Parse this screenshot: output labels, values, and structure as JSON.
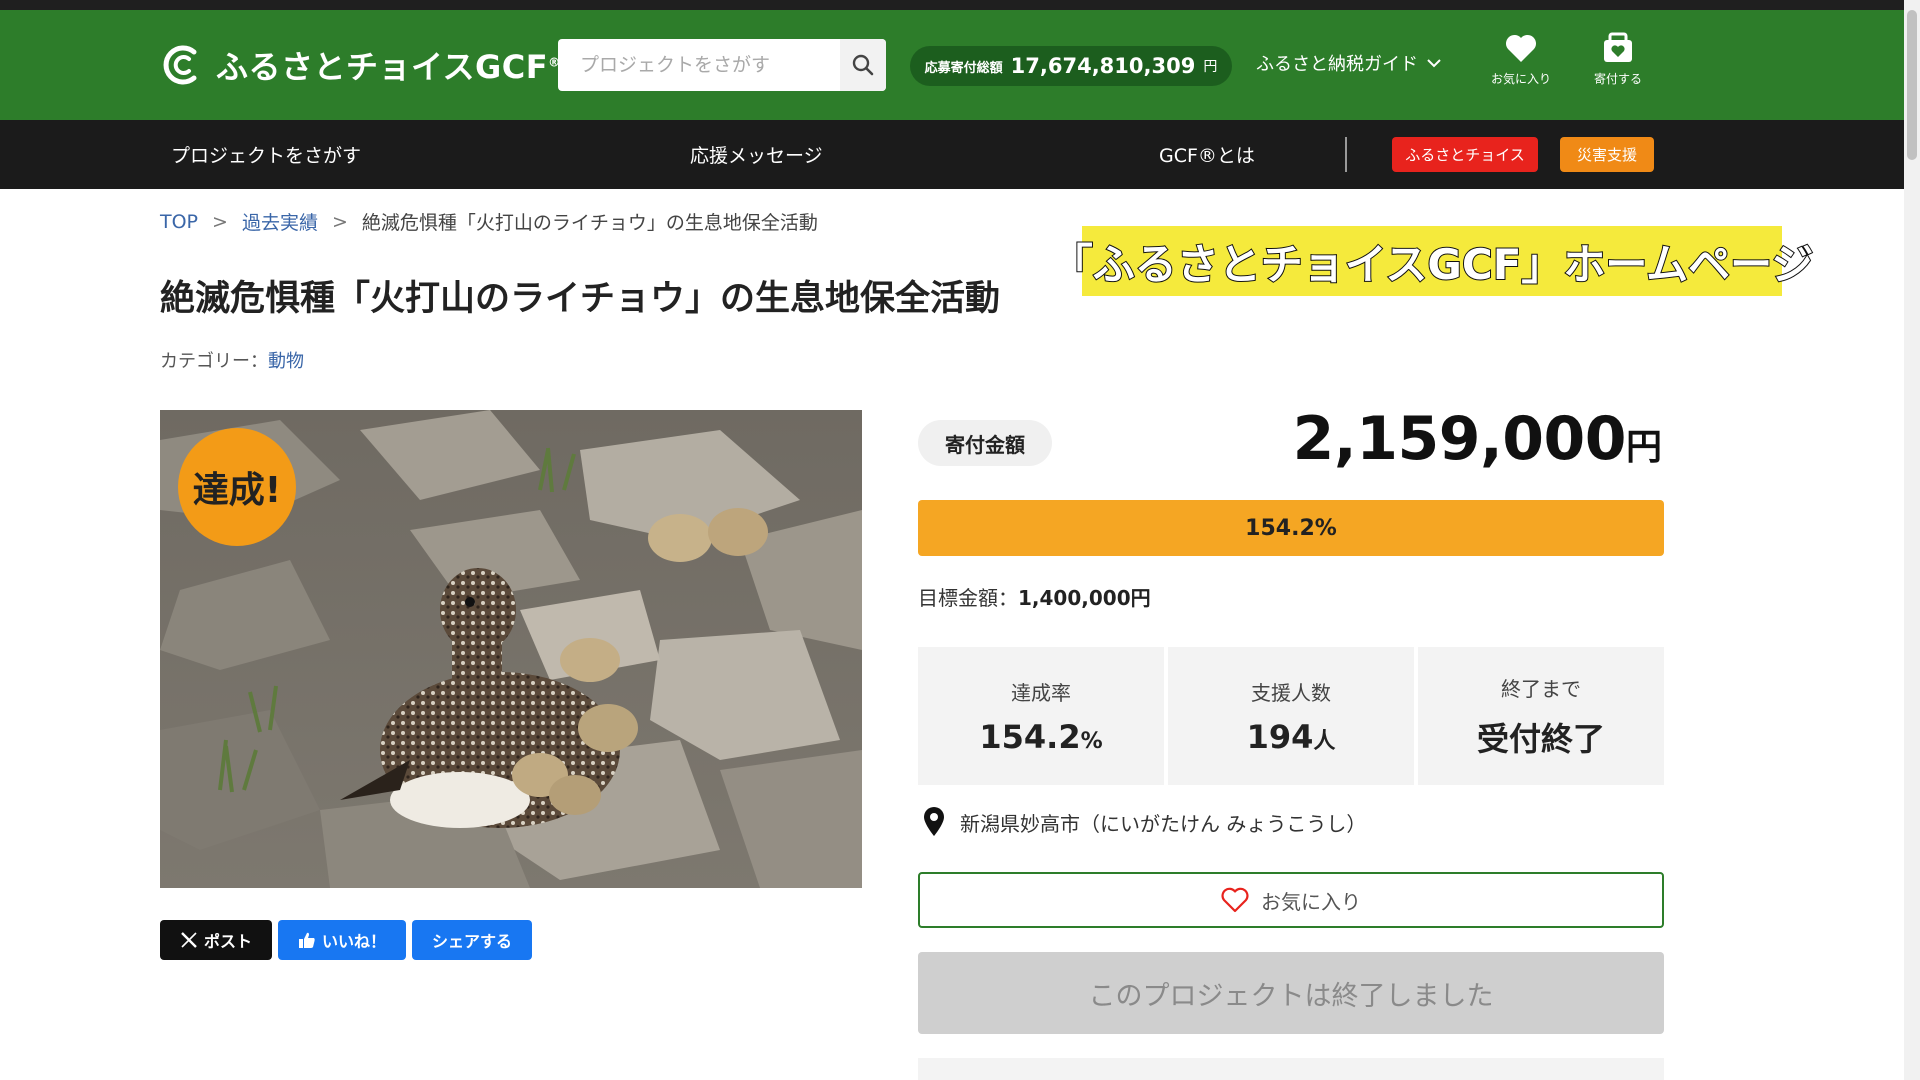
{
  "header": {
    "logo_text": "ふるさとチョイスGCF",
    "logo_reg": "®",
    "search_placeholder": "プロジェクトをさがす",
    "total_label": "応募寄付総額",
    "total_amount": "17,674,810,309",
    "total_unit": "円",
    "guide_label": "ふるさと納税ガイド",
    "favorites_label": "お気に入り",
    "donate_label": "寄付する"
  },
  "nav": {
    "items": [
      "プロジェクトをさがす",
      "応援メッセージ",
      "GCF®とは"
    ],
    "furusato_choice": "ふるさとチョイス",
    "disaster_support": "災害支援",
    "colors": {
      "furusato_choice": "#e8231d",
      "disaster_support": "#f08a16"
    }
  },
  "breadcrumb": {
    "top": "TOP",
    "sep": ">",
    "past": "過去実績",
    "current": "絶滅危惧種「火打山のライチョウ」の生息地保全活動"
  },
  "overlay_banner": "「ふるさとチョイスGCF」ホームページ",
  "project": {
    "title": "絶滅危惧種「火打山のライチョウ」の生息地保全活動",
    "category_label": "カテゴリー：",
    "category_value": "動物",
    "achieved_badge": "達成!",
    "photo_description_icon": "ptarmigan-photo"
  },
  "share": {
    "post": "ポスト",
    "like": "いいね！",
    "share": "シェアする"
  },
  "funding": {
    "amount_label": "寄付金額",
    "amount": "2,159,000",
    "amount_unit": "円",
    "progress_text": "154.2%",
    "progress_fraction": 1.0,
    "goal_label": "目標金額：",
    "goal_value": "1,400,000円",
    "stats": [
      {
        "label": "達成率",
        "value": "154.2",
        "unit": "%"
      },
      {
        "label": "支援人数",
        "value": "194",
        "unit": "人"
      },
      {
        "label": "終了まで",
        "value": "受付終了",
        "unit": ""
      }
    ],
    "location": "新潟県妙高市（にいがたけん みょうこうし）",
    "favorite_button": "お気に入り",
    "ended_button": "このプロジェクトは終了しました"
  },
  "colors": {
    "brand_green": "#2d7d2a",
    "progress": "#f5a623",
    "badge": "#f39b17",
    "x_black": "#111111",
    "fb_blue": "#1877f2"
  }
}
